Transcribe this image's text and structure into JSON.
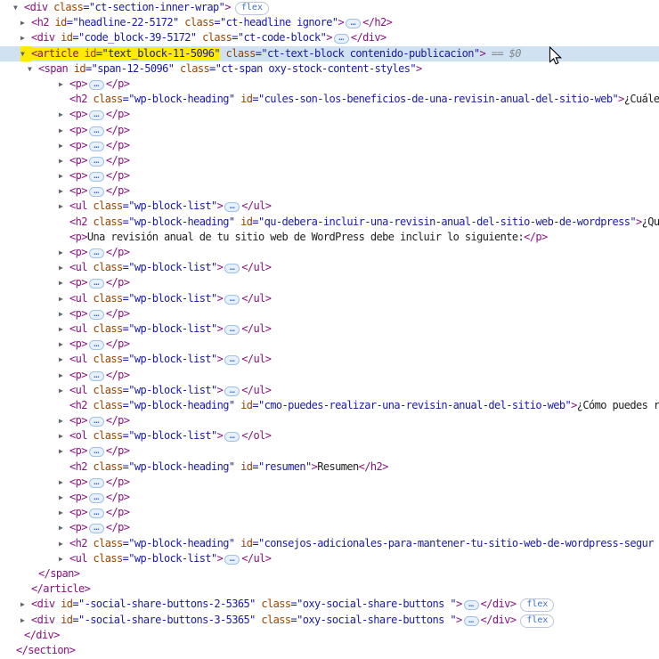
{
  "app": {
    "name": "browser-devtools-elements-panel"
  },
  "colors": {
    "tag": "#881280",
    "attr_name": "#994500",
    "attr_value": "#1a1aa6",
    "text": "#202124",
    "hint": "#80868b",
    "arrow": "#5f6368",
    "selected_row_bg": "#d0e1f2",
    "search_highlight_bg": "#ffeb00",
    "badge_text": "#3b6fc4",
    "badge_border": "#b9c6d8",
    "ellipsis_bg": "#e8f1fb",
    "ellipsis_border": "#9dc1e8",
    "ellipsis_text": "#2e6ccb"
  },
  "badge_label": "flex",
  "ellipsis_glyph": "…",
  "hint_text": " == $0",
  "rows": [
    {
      "indent": 27,
      "arrow": "down",
      "tokens": [
        [
          "t",
          "<div"
        ],
        [
          "a",
          " class"
        ],
        [
          "v",
          "=\"ct-section-inner-wrap\""
        ],
        [
          "t",
          ">"
        ],
        [
          "b",
          "flex"
        ]
      ]
    },
    {
      "indent": 35,
      "arrow": "right",
      "tokens": [
        [
          "t",
          "<h2"
        ],
        [
          "a",
          " id"
        ],
        [
          "v",
          "=\"headline-22-5172\""
        ],
        [
          "a",
          " class"
        ],
        [
          "v",
          "=\"ct-headline ignore\""
        ],
        [
          "t",
          ">"
        ],
        [
          "e"
        ],
        [
          "t",
          "</h2>"
        ]
      ]
    },
    {
      "indent": 35,
      "arrow": "right",
      "tokens": [
        [
          "t",
          "<div"
        ],
        [
          "a",
          " id"
        ],
        [
          "v",
          "=\"code_block-39-5172\""
        ],
        [
          "a",
          " class"
        ],
        [
          "v",
          "=\"ct-code-block\""
        ],
        [
          "t",
          ">"
        ],
        [
          "e"
        ],
        [
          "t",
          "</div>"
        ]
      ]
    },
    {
      "indent": 35,
      "arrow": "down",
      "arrow_hl": true,
      "selected": true,
      "tokens": [
        [
          "t",
          "<article",
          "hl"
        ],
        [
          "a",
          " id",
          "hl"
        ],
        [
          "v",
          "=\"text_block-11-5096\"",
          "hl"
        ],
        [
          "a",
          " class"
        ],
        [
          "v",
          "=\"ct-text-block contenido-publicacion\""
        ],
        [
          "t",
          ">"
        ],
        [
          "g",
          " == $0"
        ]
      ]
    },
    {
      "indent": 43,
      "arrow": "down",
      "tokens": [
        [
          "t",
          "<span"
        ],
        [
          "a",
          " id"
        ],
        [
          "v",
          "=\"span-12-5096\""
        ],
        [
          "a",
          " class"
        ],
        [
          "v",
          "=\"ct-span oxy-stock-content-styles\""
        ],
        [
          "t",
          ">"
        ]
      ]
    },
    {
      "indent": 78,
      "arrow": "right",
      "tokens": [
        [
          "t",
          "<p>"
        ],
        [
          "e"
        ],
        [
          "t",
          "</p>"
        ]
      ]
    },
    {
      "indent": 78,
      "arrow": null,
      "tokens": [
        [
          "t",
          "<h2"
        ],
        [
          "a",
          " class"
        ],
        [
          "v",
          "=\"wp-block-heading\""
        ],
        [
          "a",
          " id"
        ],
        [
          "v",
          "=\"cules-son-los-beneficios-de-una-revisin-anual-del-sitio-web\""
        ],
        [
          "t",
          ">"
        ],
        [
          "x",
          "¿Cuále"
        ]
      ]
    },
    {
      "indent": 78,
      "arrow": "right",
      "tokens": [
        [
          "t",
          "<p>"
        ],
        [
          "e"
        ],
        [
          "t",
          "</p>"
        ]
      ]
    },
    {
      "indent": 78,
      "arrow": "right",
      "tokens": [
        [
          "t",
          "<p>"
        ],
        [
          "e"
        ],
        [
          "t",
          "</p>"
        ]
      ]
    },
    {
      "indent": 78,
      "arrow": "right",
      "tokens": [
        [
          "t",
          "<p>"
        ],
        [
          "e"
        ],
        [
          "t",
          "</p>"
        ]
      ]
    },
    {
      "indent": 78,
      "arrow": "right",
      "tokens": [
        [
          "t",
          "<p>"
        ],
        [
          "e"
        ],
        [
          "t",
          "</p>"
        ]
      ]
    },
    {
      "indent": 78,
      "arrow": "right",
      "tokens": [
        [
          "t",
          "<p>"
        ],
        [
          "e"
        ],
        [
          "t",
          "</p>"
        ]
      ]
    },
    {
      "indent": 78,
      "arrow": "right",
      "tokens": [
        [
          "t",
          "<p>"
        ],
        [
          "e"
        ],
        [
          "t",
          "</p>"
        ]
      ]
    },
    {
      "indent": 78,
      "arrow": "right",
      "tokens": [
        [
          "t",
          "<ul"
        ],
        [
          "a",
          " class"
        ],
        [
          "v",
          "=\"wp-block-list\""
        ],
        [
          "t",
          ">"
        ],
        [
          "e"
        ],
        [
          "t",
          "</ul>"
        ]
      ]
    },
    {
      "indent": 78,
      "arrow": null,
      "tokens": [
        [
          "t",
          "<h2"
        ],
        [
          "a",
          " class"
        ],
        [
          "v",
          "=\"wp-block-heading\""
        ],
        [
          "a",
          " id"
        ],
        [
          "v",
          "=\"qu-debera-incluir-una-revisin-anual-del-sitio-web-de-wordpress\""
        ],
        [
          "t",
          ">"
        ],
        [
          "x",
          "¿Qu"
        ]
      ]
    },
    {
      "indent": 78,
      "arrow": null,
      "tokens": [
        [
          "t",
          "<p>"
        ],
        [
          "x",
          "Una revisión anual de tu sitio web de WordPress debe incluir lo siguiente:"
        ],
        [
          "t",
          "</p>"
        ]
      ]
    },
    {
      "indent": 78,
      "arrow": "right",
      "tokens": [
        [
          "t",
          "<p>"
        ],
        [
          "e"
        ],
        [
          "t",
          "</p>"
        ]
      ]
    },
    {
      "indent": 78,
      "arrow": "right",
      "tokens": [
        [
          "t",
          "<ul"
        ],
        [
          "a",
          " class"
        ],
        [
          "v",
          "=\"wp-block-list\""
        ],
        [
          "t",
          ">"
        ],
        [
          "e"
        ],
        [
          "t",
          "</ul>"
        ]
      ]
    },
    {
      "indent": 78,
      "arrow": "right",
      "tokens": [
        [
          "t",
          "<p>"
        ],
        [
          "e"
        ],
        [
          "t",
          "</p>"
        ]
      ]
    },
    {
      "indent": 78,
      "arrow": "right",
      "tokens": [
        [
          "t",
          "<ul"
        ],
        [
          "a",
          " class"
        ],
        [
          "v",
          "=\"wp-block-list\""
        ],
        [
          "t",
          ">"
        ],
        [
          "e"
        ],
        [
          "t",
          "</ul>"
        ]
      ]
    },
    {
      "indent": 78,
      "arrow": "right",
      "tokens": [
        [
          "t",
          "<p>"
        ],
        [
          "e"
        ],
        [
          "t",
          "</p>"
        ]
      ]
    },
    {
      "indent": 78,
      "arrow": "right",
      "tokens": [
        [
          "t",
          "<ul"
        ],
        [
          "a",
          " class"
        ],
        [
          "v",
          "=\"wp-block-list\""
        ],
        [
          "t",
          ">"
        ],
        [
          "e"
        ],
        [
          "t",
          "</ul>"
        ]
      ]
    },
    {
      "indent": 78,
      "arrow": "right",
      "tokens": [
        [
          "t",
          "<p>"
        ],
        [
          "e"
        ],
        [
          "t",
          "</p>"
        ]
      ]
    },
    {
      "indent": 78,
      "arrow": "right",
      "tokens": [
        [
          "t",
          "<ul"
        ],
        [
          "a",
          " class"
        ],
        [
          "v",
          "=\"wp-block-list\""
        ],
        [
          "t",
          ">"
        ],
        [
          "e"
        ],
        [
          "t",
          "</ul>"
        ]
      ]
    },
    {
      "indent": 78,
      "arrow": "right",
      "tokens": [
        [
          "t",
          "<p>"
        ],
        [
          "e"
        ],
        [
          "t",
          "</p>"
        ]
      ]
    },
    {
      "indent": 78,
      "arrow": "right",
      "tokens": [
        [
          "t",
          "<ul"
        ],
        [
          "a",
          " class"
        ],
        [
          "v",
          "=\"wp-block-list\""
        ],
        [
          "t",
          ">"
        ],
        [
          "e"
        ],
        [
          "t",
          "</ul>"
        ]
      ]
    },
    {
      "indent": 78,
      "arrow": null,
      "tokens": [
        [
          "t",
          "<h2"
        ],
        [
          "a",
          " class"
        ],
        [
          "v",
          "=\"wp-block-heading\""
        ],
        [
          "a",
          " id"
        ],
        [
          "v",
          "=\"cmo-puedes-realizar-una-revisin-anual-del-sitio-web\""
        ],
        [
          "t",
          ">"
        ],
        [
          "x",
          "¿Cómo puedes r"
        ]
      ]
    },
    {
      "indent": 78,
      "arrow": "right",
      "tokens": [
        [
          "t",
          "<p>"
        ],
        [
          "e"
        ],
        [
          "t",
          "</p>"
        ]
      ]
    },
    {
      "indent": 78,
      "arrow": "right",
      "tokens": [
        [
          "t",
          "<ol"
        ],
        [
          "a",
          " class"
        ],
        [
          "v",
          "=\"wp-block-list\""
        ],
        [
          "t",
          ">"
        ],
        [
          "e"
        ],
        [
          "t",
          "</ol>"
        ]
      ]
    },
    {
      "indent": 78,
      "arrow": "right",
      "tokens": [
        [
          "t",
          "<p>"
        ],
        [
          "e"
        ],
        [
          "t",
          "</p>"
        ]
      ]
    },
    {
      "indent": 78,
      "arrow": null,
      "tokens": [
        [
          "t",
          "<h2"
        ],
        [
          "a",
          " class"
        ],
        [
          "v",
          "=\"wp-block-heading\""
        ],
        [
          "a",
          " id"
        ],
        [
          "v",
          "=\"resumen\""
        ],
        [
          "t",
          ">"
        ],
        [
          "x",
          "Resumen"
        ],
        [
          "t",
          "</h2>"
        ]
      ]
    },
    {
      "indent": 78,
      "arrow": "right",
      "tokens": [
        [
          "t",
          "<p>"
        ],
        [
          "e"
        ],
        [
          "t",
          "</p>"
        ]
      ]
    },
    {
      "indent": 78,
      "arrow": "right",
      "tokens": [
        [
          "t",
          "<p>"
        ],
        [
          "e"
        ],
        [
          "t",
          "</p>"
        ]
      ]
    },
    {
      "indent": 78,
      "arrow": "right",
      "tokens": [
        [
          "t",
          "<p>"
        ],
        [
          "e"
        ],
        [
          "t",
          "</p>"
        ]
      ]
    },
    {
      "indent": 78,
      "arrow": "right",
      "tokens": [
        [
          "t",
          "<p>"
        ],
        [
          "e"
        ],
        [
          "t",
          "</p>"
        ]
      ]
    },
    {
      "indent": 78,
      "arrow": "right",
      "tokens": [
        [
          "t",
          "<h2"
        ],
        [
          "a",
          " class"
        ],
        [
          "v",
          "=\"wp-block-heading\""
        ],
        [
          "a",
          " id"
        ],
        [
          "v",
          "=\"consejos-adicionales-para-mantener-tu-sitio-web-de-wordpress-segur"
        ]
      ]
    },
    {
      "indent": 78,
      "arrow": "right",
      "tokens": [
        [
          "t",
          "<ul"
        ],
        [
          "a",
          " class"
        ],
        [
          "v",
          "=\"wp-block-list\""
        ],
        [
          "t",
          ">"
        ],
        [
          "e"
        ],
        [
          "t",
          "</ul>"
        ]
      ]
    },
    {
      "indent": 43,
      "arrow": null,
      "tokens": [
        [
          "t",
          "</span>"
        ]
      ]
    },
    {
      "indent": 35,
      "arrow": null,
      "tokens": [
        [
          "t",
          "</article>"
        ]
      ]
    },
    {
      "indent": 35,
      "arrow": "right",
      "tokens": [
        [
          "t",
          "<div"
        ],
        [
          "a",
          " id"
        ],
        [
          "v",
          "=\"-social-share-buttons-2-5365\""
        ],
        [
          "a",
          " class"
        ],
        [
          "v",
          "=\"oxy-social-share-buttons \""
        ],
        [
          "t",
          ">"
        ],
        [
          "e"
        ],
        [
          "t",
          "</div>"
        ],
        [
          "b",
          "flex"
        ]
      ]
    },
    {
      "indent": 35,
      "arrow": "right",
      "tokens": [
        [
          "t",
          "<div"
        ],
        [
          "a",
          " id"
        ],
        [
          "v",
          "=\"-social-share-buttons-3-5365\""
        ],
        [
          "a",
          " class"
        ],
        [
          "v",
          "=\"oxy-social-share-buttons \""
        ],
        [
          "t",
          ">"
        ],
        [
          "e"
        ],
        [
          "t",
          "</div>"
        ],
        [
          "b",
          "flex"
        ]
      ]
    },
    {
      "indent": 27,
      "arrow": null,
      "tokens": [
        [
          "t",
          "</div>"
        ]
      ]
    },
    {
      "indent": 18,
      "arrow": null,
      "tokens": [
        [
          "t",
          "</section>"
        ]
      ]
    }
  ]
}
